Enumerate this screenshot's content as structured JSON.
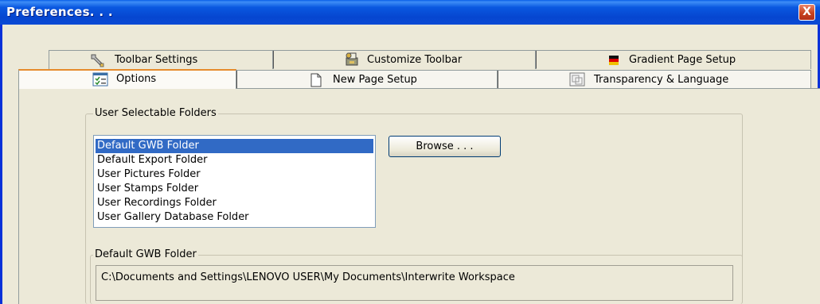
{
  "window": {
    "title": "Preferences. . .",
    "close_glyph": "X"
  },
  "tabs": {
    "back_row": [
      {
        "label": "Toolbar Settings",
        "icon": "wrench-icon"
      },
      {
        "label": "Customize Toolbar",
        "icon": "printer-tools-icon"
      },
      {
        "label": "Gradient Page Setup",
        "icon": "flag-icon"
      }
    ],
    "front_row": [
      {
        "label": "Options",
        "icon": "options-checklist-icon",
        "active": true
      },
      {
        "label": "New Page Setup",
        "icon": "blank-page-icon"
      },
      {
        "label": "Transparency & Language",
        "icon": "transparency-icon"
      }
    ]
  },
  "folders_group": {
    "legend": "User Selectable Folders",
    "items": [
      "Default GWB Folder",
      "Default Export Folder",
      "User Pictures Folder",
      "User Stamps Folder",
      "User Recordings Folder",
      "User Gallery Database Folder"
    ],
    "selected_index": 0,
    "browse_label": "Browse . . ."
  },
  "path_group": {
    "legend": "Default GWB Folder",
    "path": "C:\\Documents and Settings\\LENOVO USER\\My Documents\\Interwrite Workspace"
  },
  "colors": {
    "titlebar": "#0a58e0",
    "selection": "#316ac5",
    "dialog_bg": "#ece9d8",
    "close_button": "#c8431e"
  }
}
